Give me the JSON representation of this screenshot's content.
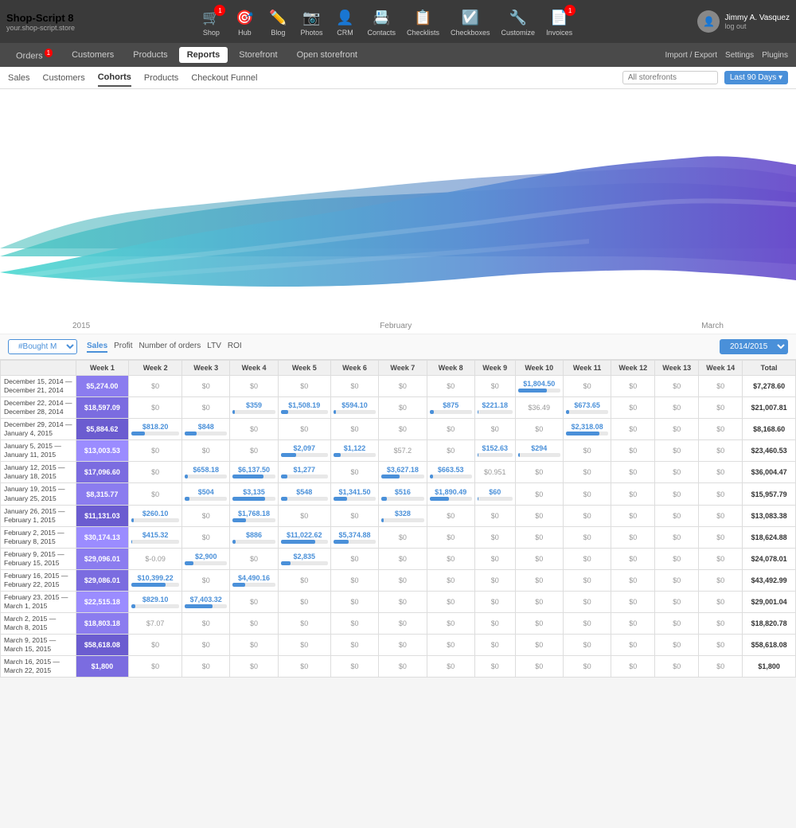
{
  "brand": {
    "name": "Shop-Script 8",
    "url": "your.shop-script.store"
  },
  "top_icons": [
    {
      "label": "Shop",
      "icon": "🛒",
      "badge": "1"
    },
    {
      "label": "Hub",
      "icon": "🎯",
      "badge": null
    },
    {
      "label": "Blog",
      "icon": "✏️",
      "badge": null
    },
    {
      "label": "Photos",
      "icon": "📷",
      "badge": null
    },
    {
      "label": "CRM",
      "icon": "👤",
      "badge": null
    },
    {
      "label": "Contacts",
      "icon": "📇",
      "badge": null
    },
    {
      "label": "Checklists",
      "icon": "📋",
      "badge": null
    },
    {
      "label": "Checkboxes",
      "icon": "☑️",
      "badge": null
    },
    {
      "label": "Customize",
      "icon": "🔧",
      "badge": null
    },
    {
      "label": "Invoices",
      "icon": "📄",
      "badge": "1"
    }
  ],
  "user": {
    "name": "Jimmy A. Vasquez",
    "sub": "log out"
  },
  "main_nav": {
    "items": [
      {
        "label": "Orders",
        "badge": "1"
      },
      {
        "label": "Customers"
      },
      {
        "label": "Products"
      },
      {
        "label": "Reports",
        "active": true
      },
      {
        "label": "Storefront"
      },
      {
        "label": "Open storefront"
      }
    ],
    "right": [
      "Import / Export",
      "Settings",
      "Plugins"
    ]
  },
  "sub_nav": {
    "items": [
      {
        "label": "Sales"
      },
      {
        "label": "Customers"
      },
      {
        "label": "Cohorts",
        "active": true
      },
      {
        "label": "Products"
      },
      {
        "label": "Checkout Funnel"
      }
    ],
    "search_placeholder": "All storefronts",
    "date_filter": "Last 90 Days ▾"
  },
  "chart": {
    "x_labels": [
      "2015",
      "",
      "February",
      "",
      "March"
    ]
  },
  "cohort_controls": {
    "select_label": "#Bought M",
    "metrics": [
      {
        "label": "Sales",
        "active": true
      },
      {
        "label": "Profit"
      },
      {
        "label": "Number of orders"
      },
      {
        "label": "LTV"
      },
      {
        "label": "ROI"
      }
    ],
    "year_select": "2014/2015"
  },
  "table": {
    "headers": [
      "Week 1",
      "Week 2",
      "Week 3",
      "Week 4",
      "Week 5",
      "Week 6",
      "Week 7",
      "Week 8",
      "Week 9",
      "Week 10",
      "Week 11",
      "Week 12",
      "Week 13",
      "Week 14",
      "Total"
    ],
    "rows": [
      {
        "label": "December 15, 2014 —\nDecember 21, 2014",
        "cells": [
          "$5,274.00",
          "$0",
          "$0",
          "$0",
          "$0",
          "$0",
          "$0",
          "$0",
          "$0",
          "$1,804.50",
          "$0",
          "$0",
          "$0",
          "$0"
        ],
        "bars": [
          100,
          0,
          0,
          0,
          0,
          0,
          0,
          0,
          0,
          34,
          0,
          0,
          0,
          0
        ],
        "total": "$7,278.60"
      },
      {
        "label": "December 22, 2014 —\nDecember 28, 2014",
        "cells": [
          "$18,597.09",
          "$0",
          "$0",
          "$359",
          "$1,508.19",
          "$594.10",
          "$0",
          "$875",
          "$221.18",
          "$36.49",
          "$673.65",
          "$0",
          "$0",
          "$0"
        ],
        "bars": [
          100,
          0,
          0,
          2,
          8,
          3,
          0,
          5,
          1,
          0,
          4,
          0,
          0,
          0
        ],
        "total": "$21,007.81"
      },
      {
        "label": "December 29, 2014 —\nJanuary 4, 2015",
        "cells": [
          "$5,884.62",
          "$818.20",
          "$848",
          "$0",
          "$0",
          "$0",
          "$0",
          "$0",
          "$0",
          "$0",
          "$2,318.08",
          "$0",
          "$0",
          "$0"
        ],
        "bars": [
          100,
          14,
          14,
          0,
          0,
          0,
          0,
          0,
          0,
          0,
          39,
          0,
          0,
          0
        ],
        "total": "$8,168.60"
      },
      {
        "label": "January 5, 2015 —\nJanuary 11, 2015",
        "cells": [
          "$13,003.53",
          "$0",
          "$0",
          "$0",
          "$2,097",
          "$1,122",
          "$57.2",
          "$0",
          "$152.63",
          "$294",
          "$0",
          "$0",
          "$0",
          "$0"
        ],
        "bars": [
          100,
          0,
          0,
          0,
          16,
          9,
          0,
          0,
          1,
          2,
          0,
          0,
          0,
          0
        ],
        "total": "$23,460.53"
      },
      {
        "label": "January 12, 2015 —\nJanuary 18, 2015",
        "cells": [
          "$17,096.60",
          "$0",
          "$658.18",
          "$6,137.50",
          "$1,277",
          "$0",
          "$3,627.18",
          "$663.53",
          "$0.951",
          "$0",
          "$0",
          "$0",
          "$0",
          "$0"
        ],
        "bars": [
          100,
          0,
          4,
          36,
          7,
          0,
          21,
          4,
          0,
          0,
          0,
          0,
          0,
          0
        ],
        "total": "$36,004.47"
      },
      {
        "label": "January 19, 2015 —\nJanuary 25, 2015",
        "cells": [
          "$8,315.77",
          "$0",
          "$504",
          "$3,135",
          "$548",
          "$1,341.50",
          "$516",
          "$1,890.49",
          "$60",
          "$0",
          "$0",
          "$0",
          "$0",
          "$0"
        ],
        "bars": [
          100,
          0,
          6,
          38,
          7,
          16,
          6,
          23,
          1,
          0,
          0,
          0,
          0,
          0
        ],
        "total": "$15,957.79"
      },
      {
        "label": "January 26, 2015 —\nFebruary 1, 2015",
        "cells": [
          "$11,131.03",
          "$260.10",
          "$0",
          "$1,768.18",
          "$0",
          "$0",
          "$328",
          "$0",
          "$0",
          "$0",
          "$0",
          "$0",
          "$0",
          "$0"
        ],
        "bars": [
          100,
          2,
          0,
          16,
          0,
          0,
          3,
          0,
          0,
          0,
          0,
          0,
          0,
          0
        ],
        "total": "$13,083.38"
      },
      {
        "label": "February 2, 2015 —\nFebruary 8, 2015",
        "cells": [
          "$30,174.13",
          "$415.32",
          "$0",
          "$886",
          "$11,022.62",
          "$5,374.88",
          "$0",
          "$0",
          "$0",
          "$0",
          "$0",
          "$0",
          "$0",
          "$0"
        ],
        "bars": [
          100,
          1,
          0,
          3,
          37,
          18,
          0,
          0,
          0,
          0,
          0,
          0,
          0,
          0
        ],
        "total": "$18,624.88"
      },
      {
        "label": "February 9, 2015 —\nFebruary 15, 2015",
        "cells": [
          "$29,096.01",
          "$-0.09",
          "$2,900",
          "$0",
          "$2,835",
          "$0",
          "$0",
          "$0",
          "$0",
          "$0",
          "$0",
          "$0",
          "$0",
          "$0"
        ],
        "bars": [
          100,
          0,
          10,
          0,
          10,
          0,
          0,
          0,
          0,
          0,
          0,
          0,
          0,
          0
        ],
        "total": "$24,078.01"
      },
      {
        "label": "February 16, 2015 —\nFebruary 22, 2015",
        "cells": [
          "$29,086.01",
          "$10,399.22",
          "$0",
          "$4,490.16",
          "$0",
          "$0",
          "$0",
          "$0",
          "$0",
          "$0",
          "$0",
          "$0",
          "$0",
          "$0"
        ],
        "bars": [
          100,
          36,
          0,
          15,
          0,
          0,
          0,
          0,
          0,
          0,
          0,
          0,
          0,
          0
        ],
        "total": "$43,492.99"
      },
      {
        "label": "February 23, 2015 —\nMarch 1, 2015",
        "cells": [
          "$22,515.18",
          "$829.10",
          "$7,403.32",
          "$0",
          "$0",
          "$0",
          "$0",
          "$0",
          "$0",
          "$0",
          "$0",
          "$0",
          "$0",
          "$0"
        ],
        "bars": [
          100,
          4,
          33,
          0,
          0,
          0,
          0,
          0,
          0,
          0,
          0,
          0,
          0,
          0
        ],
        "total": "$29,001.04"
      },
      {
        "label": "March 2, 2015 —\nMarch 8, 2015",
        "cells": [
          "$18,803.18",
          "$7.07",
          "$0",
          "$0",
          "$0",
          "$0",
          "$0",
          "$0",
          "$0",
          "$0",
          "$0",
          "$0",
          "$0",
          "$0"
        ],
        "bars": [
          100,
          0,
          0,
          0,
          0,
          0,
          0,
          0,
          0,
          0,
          0,
          0,
          0,
          0
        ],
        "total": "$18,820.78"
      },
      {
        "label": "March 9, 2015 —\nMarch 15, 2015",
        "cells": [
          "$58,618.08",
          "$0",
          "$0",
          "$0",
          "$0",
          "$0",
          "$0",
          "$0",
          "$0",
          "$0",
          "$0",
          "$0",
          "$0",
          "$0"
        ],
        "bars": [
          100,
          0,
          0,
          0,
          0,
          0,
          0,
          0,
          0,
          0,
          0,
          0,
          0,
          0
        ],
        "total": "$58,618.08"
      },
      {
        "label": "March 16, 2015 —\nMarch 22, 2015",
        "cells": [
          "$1,800",
          "$0",
          "$0",
          "$0",
          "$0",
          "$0",
          "$0",
          "$0",
          "$0",
          "$0",
          "$0",
          "$0",
          "$0",
          "$0"
        ],
        "bars": [
          100,
          0,
          0,
          0,
          0,
          0,
          0,
          0,
          0,
          0,
          0,
          0,
          0,
          0
        ],
        "total": "$1,800"
      }
    ]
  }
}
